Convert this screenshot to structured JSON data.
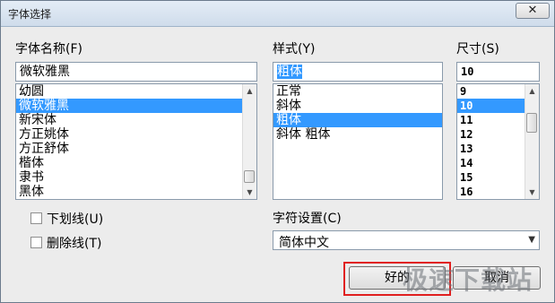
{
  "window": {
    "title": "字体选择",
    "close_label": "✕"
  },
  "font_name": {
    "label": "字体名称(F)",
    "value": "微软雅黑",
    "items": [
      "幼圆",
      "微软雅黑",
      "新宋体",
      "方正姚体",
      "方正舒体",
      "楷体",
      "隶书",
      "黑体"
    ],
    "selected_index": 1
  },
  "style": {
    "label": "样式(Y)",
    "value": "粗体",
    "items": [
      "正常",
      "斜体",
      "粗体",
      "斜体 粗体"
    ],
    "selected_index": 2
  },
  "size": {
    "label": "尺寸(S)",
    "value": "10",
    "items": [
      "9",
      "10",
      "11",
      "12",
      "13",
      "14",
      "15",
      "16"
    ],
    "selected_index": 1
  },
  "effects": {
    "underline_label": "下划线(U)",
    "strikeout_label": "删除线(T)"
  },
  "charset": {
    "label": "字符设置(C)",
    "value": "简体中文"
  },
  "buttons": {
    "ok_label": "好的",
    "cancel_label": "取消"
  },
  "watermark": "极速下载站",
  "colors": {
    "selection": "#3399ff",
    "highlight_box": "#e02020"
  }
}
